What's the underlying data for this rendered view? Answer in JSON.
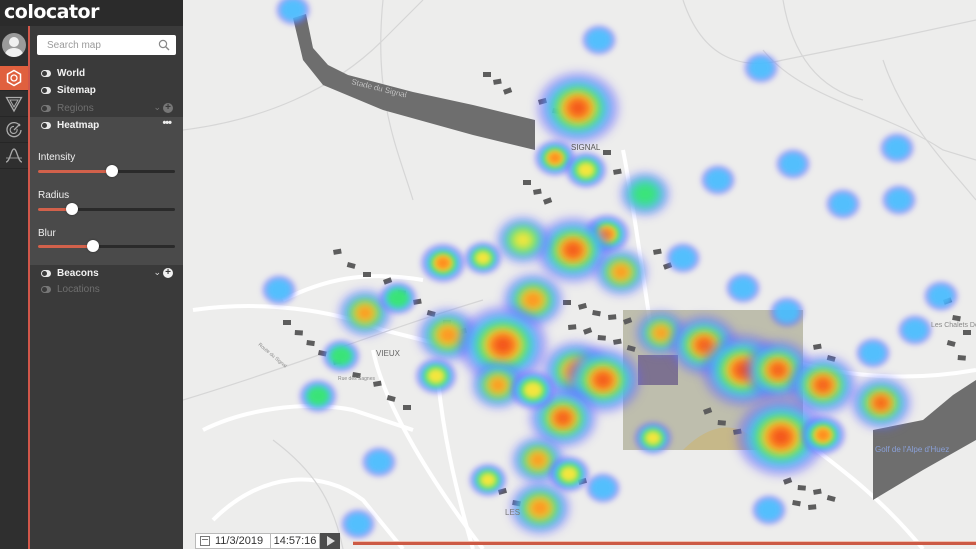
{
  "app": {
    "name": "colocator"
  },
  "rail": {
    "items": [
      {
        "name": "layers",
        "icon": "hexagon-target-icon",
        "active": true
      },
      {
        "name": "filters",
        "icon": "funnel-triangle-icon",
        "active": false
      },
      {
        "name": "radar",
        "icon": "radar-icon",
        "active": false
      },
      {
        "name": "distribution",
        "icon": "bell-curve-icon",
        "active": false
      }
    ]
  },
  "search": {
    "placeholder": "Search map",
    "value": ""
  },
  "layers": {
    "world": {
      "label": "World",
      "enabled": true
    },
    "sitemap": {
      "label": "Sitemap",
      "enabled": true
    },
    "regions": {
      "label": "Regions",
      "enabled": false
    },
    "heatmap": {
      "label": "Heatmap",
      "enabled": true,
      "more": "•••"
    },
    "beacons": {
      "label": "Beacons",
      "enabled": true
    },
    "locations": {
      "label": "Locations",
      "enabled": false
    }
  },
  "heatmap_settings": {
    "intensity": {
      "label": "Intensity",
      "value": 0.54
    },
    "radius": {
      "label": "Radius",
      "value": 0.25
    },
    "blur": {
      "label": "Blur",
      "value": 0.4
    }
  },
  "map": {
    "labels": {
      "stadium": "Stade du Signal",
      "signal": "SIGNAL",
      "vieux": "VIEUX",
      "chalets": "Les Chalets De l'Altiport",
      "golf": "Golf de l'Alpe d'Huez",
      "rue": "Rue des Sagnes",
      "route": "Route du Signal",
      "les": "LES"
    },
    "heat_gradient": [
      "#6a5cff",
      "#45c4ff",
      "#39e86a",
      "#ffe63a",
      "#ff8a1e",
      "#f0461c"
    ]
  },
  "timeline": {
    "date": "11/3/2019",
    "time": "14:57:16",
    "accent": "#cc5a45"
  }
}
